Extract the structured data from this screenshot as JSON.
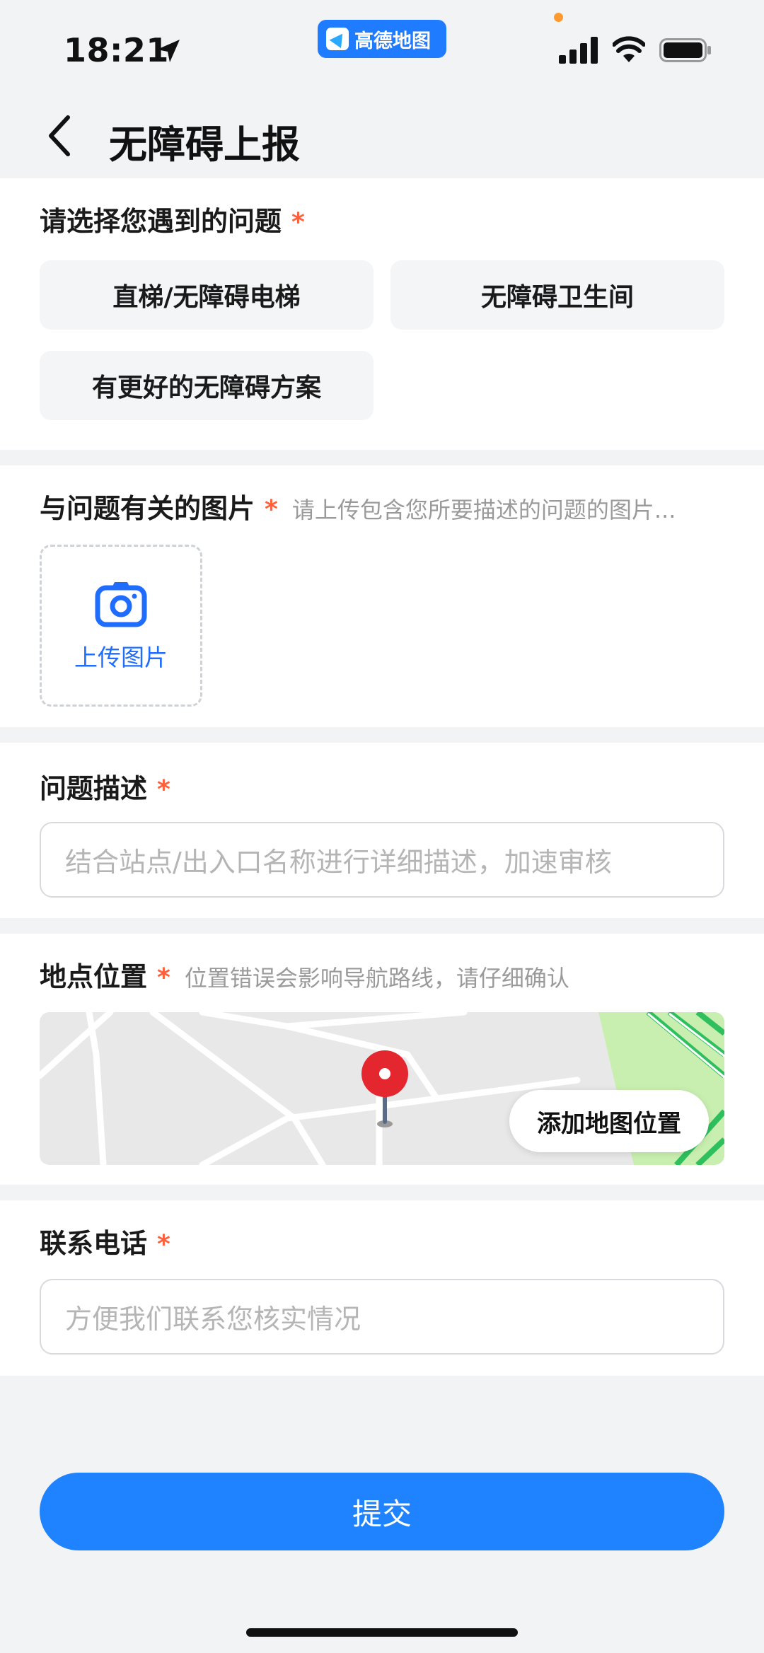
{
  "status_bar": {
    "time": "18:21",
    "app_badge": "高德地图",
    "icons": [
      "location-arrow-icon",
      "signal-icon",
      "wifi-icon",
      "battery-icon"
    ]
  },
  "header": {
    "title": "无障碍上报",
    "back_icon": "chevron-left-icon"
  },
  "problem_section": {
    "title": "请选择您遇到的问题",
    "required_mark": "*",
    "options": [
      "直梯/无障碍电梯",
      "无障碍卫生间",
      "有更好的无障碍方案"
    ]
  },
  "photo_section": {
    "title": "与问题有关的图片",
    "required_mark": "*",
    "hint": "请上传包含您所要描述的问题的图片...",
    "upload_label": "上传图片",
    "upload_icon": "camera-icon"
  },
  "description_section": {
    "title": "问题描述",
    "required_mark": "*",
    "placeholder": "结合站点/出入口名称进行详细描述，加速审核"
  },
  "location_section": {
    "title": "地点位置",
    "required_mark": "*",
    "hint": "位置错误会影响导航路线，请仔细确认",
    "map_button": "添加地图位置",
    "pin_icon": "map-pin-icon"
  },
  "phone_section": {
    "title": "联系电话",
    "required_mark": "*",
    "placeholder": "方便我们联系您核实情况"
  },
  "submit_label": "提交",
  "colors": {
    "accent": "#1f82ff",
    "required": "#ff5f3a",
    "link": "#1f6dff"
  }
}
